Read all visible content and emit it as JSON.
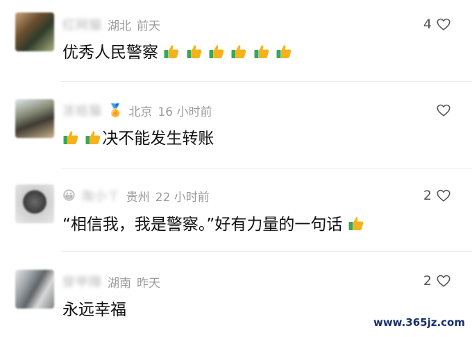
{
  "comments": [
    {
      "avatar_icon": "user-avatar-icon",
      "nickname": "红网猫",
      "location": "湖北",
      "time": "前天",
      "like_count": "4",
      "text": "优秀人民警察",
      "thumbs_before": 0,
      "thumbs_after": 6
    },
    {
      "avatar_icon": "user-avatar-icon",
      "nickname": "凉桔猫",
      "location": "北京",
      "time": "16 小时前",
      "like_count": "",
      "text": "决不能发生转账",
      "thumbs_before": 2,
      "thumbs_after": 0
    },
    {
      "avatar_icon": "user-avatar-icon",
      "nickname": "淘小丫",
      "location": "贵州",
      "time": "22 小时前",
      "like_count": "2",
      "text": "“相信我，我是警察。”好有力量的一句话",
      "thumbs_before": 0,
      "thumbs_after": 1
    },
    {
      "avatar_icon": "user-avatar-icon",
      "nickname": "穿甲障",
      "location": "湖南",
      "time": "昨天",
      "like_count": "2",
      "text": "永远幸福",
      "thumbs_before": 0,
      "thumbs_after": 0
    }
  ],
  "watermark": "www.365jz.com",
  "colors": {
    "meta_gray": "#9b9b9b",
    "text_black": "#111111",
    "thumb_yellow": "#f5b21b",
    "thumb_cuff_green": "#3aa757",
    "watermark_blue": "#17306a"
  }
}
